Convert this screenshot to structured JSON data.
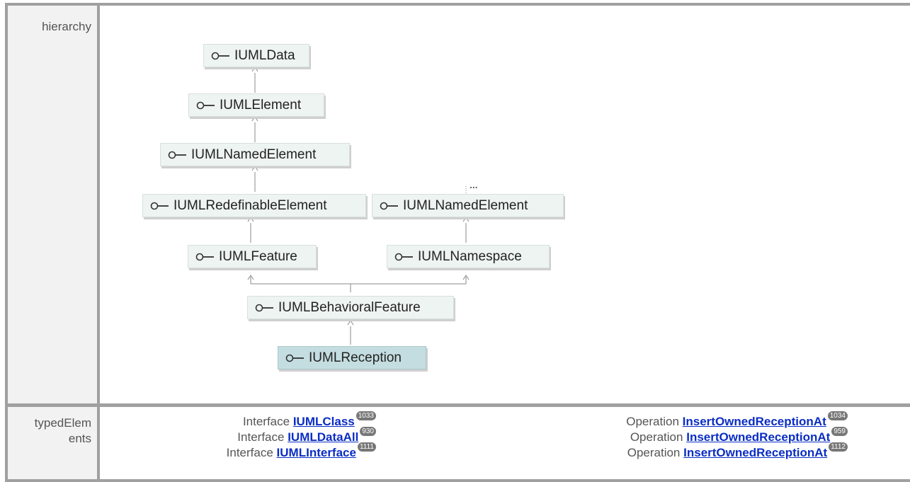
{
  "rows": {
    "hierarchy_label": "hierarchy",
    "typed_label_1": "typedElem",
    "typed_label_2": "ents"
  },
  "hierarchy": {
    "nodes": [
      {
        "name": "IUMLData"
      },
      {
        "name": "IUMLElement"
      },
      {
        "name": "IUMLNamedElement"
      },
      {
        "name": "IUMLRedefinableElement"
      },
      {
        "name": "IUMLNamedElement"
      },
      {
        "name": "IUMLFeature"
      },
      {
        "name": "IUMLNamespace"
      },
      {
        "name": "IUMLBehavioralFeature"
      },
      {
        "name": "IUMLReception"
      }
    ],
    "ellipsis": "...",
    "icon": "interface-lollipop-icon",
    "node_color": "#eef4f1",
    "selected_color": "#c4dde1"
  },
  "typed_elements": {
    "left": [
      {
        "kind": "Interface",
        "name": "IUMLClass",
        "count": "1033"
      },
      {
        "kind": "Interface",
        "name": "IUMLDataAll",
        "count": "930"
      },
      {
        "kind": "Interface",
        "name": "IUMLInterface",
        "count": "1111"
      }
    ],
    "right": [
      {
        "kind": "Operation",
        "name": "InsertOwnedReceptionAt",
        "count": "1034"
      },
      {
        "kind": "Operation",
        "name": "InsertOwnedReceptionAt",
        "count": "959"
      },
      {
        "kind": "Operation",
        "name": "InsertOwnedReceptionAt",
        "count": "1112"
      }
    ],
    "link_color": "#0a2dc4"
  }
}
